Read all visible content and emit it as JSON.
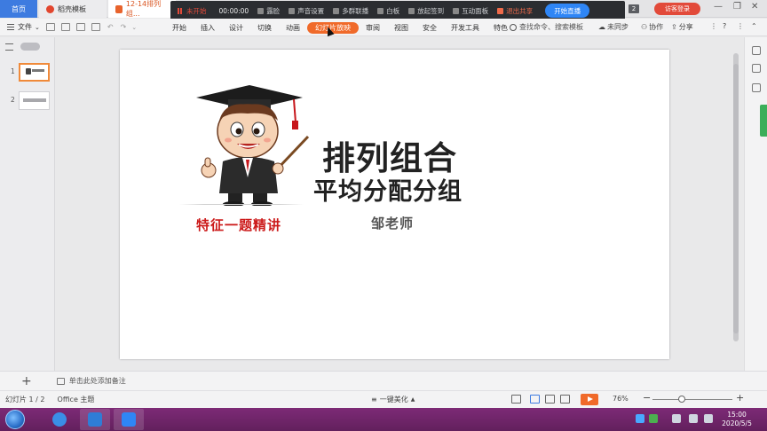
{
  "tabs": {
    "home": "首页",
    "template": "稻壳模板",
    "document": "12-14排列组..."
  },
  "recorder": {
    "state": "未开始",
    "time": "00:00:00",
    "items": [
      "露脸",
      "声音设置",
      "多群联播",
      "白板",
      "放起签到",
      "互动面板"
    ],
    "exit": "退出共享",
    "live": "开始直播"
  },
  "window": {
    "badge": "2",
    "login": "访客登录"
  },
  "menubar": {
    "file": "文件",
    "tabs": [
      "开始",
      "插入",
      "设计",
      "切换",
      "动画",
      "幻灯片放映",
      "审阅",
      "视图",
      "安全",
      "开发工具",
      "特色"
    ],
    "active_tab": "幻灯片放映",
    "search": "查找命令、搜索模板",
    "sync": "未同步",
    "collab": "协作",
    "share": "分享"
  },
  "pane": {
    "slides": [
      {
        "num": "1"
      },
      {
        "num": "2"
      }
    ]
  },
  "slide": {
    "title": "排列组合",
    "subtitle": "平均分配分组",
    "author": "邹老师",
    "tagline": "特征一题精讲"
  },
  "notes": {
    "placeholder": "单击此处添加备注"
  },
  "status": {
    "slide_counter": "幻灯片 1 / 2",
    "theme": "Office 主题",
    "beautify": "一键美化",
    "zoom": "76%"
  },
  "taskbar": {
    "time": "15:00",
    "date": "2020/5/5"
  },
  "colors": {
    "accent": "#f06a2a",
    "live_button": "#2f86f6",
    "tagline": "#cc1a1a",
    "taskbar": "#6a2464"
  }
}
